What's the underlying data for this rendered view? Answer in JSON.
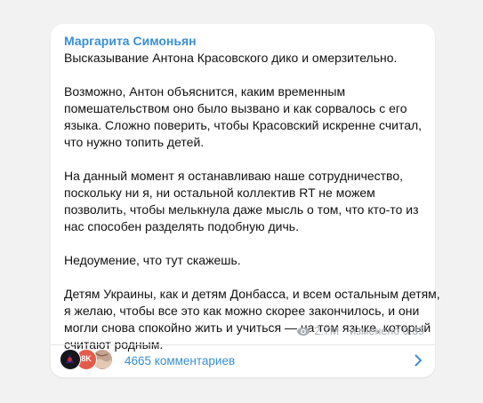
{
  "post": {
    "author": "Маргарита Симоньян",
    "paragraphs": [
      [
        "Высказывание Антона Красовского дико и омерзительно."
      ],
      [
        "Возможно, Антон объяснится, каким временным",
        "помешательством оно было вызвано и как сорвалось с его",
        "языка. Сложно поверить, чтобы Красовский искренне считал,",
        "что нужно топить детей."
      ],
      [
        "На данный момент я останавливаю наше сотрудничество,",
        "поскольку ни я, ни остальной коллектив RT не можем",
        "позволить, чтобы  мелькнула даже мысль о том, что кто-то из",
        "нас способен разделять  подобную дичь."
      ],
      [
        "Недоумение, что тут скажешь."
      ],
      [
        "Детям Украины, как и детям Донбасса, и всем остальным детям,",
        "я желаю, чтобы все это как можно скорее закончилось, и они",
        "могли снова спокойно жить и учиться — на том языке, который",
        "считают родным."
      ]
    ],
    "views": "2.7M",
    "edited": "изменено 0:39",
    "comments_label": "4665 комментариев",
    "avatar_badge": "8K"
  },
  "colors": {
    "accent": "#3a8fd3",
    "background": "#f2f2f2",
    "bubble": "#ffffff",
    "meta": "#a8aeb3"
  },
  "icons": [
    "eye-icon",
    "chevron-right-icon"
  ]
}
